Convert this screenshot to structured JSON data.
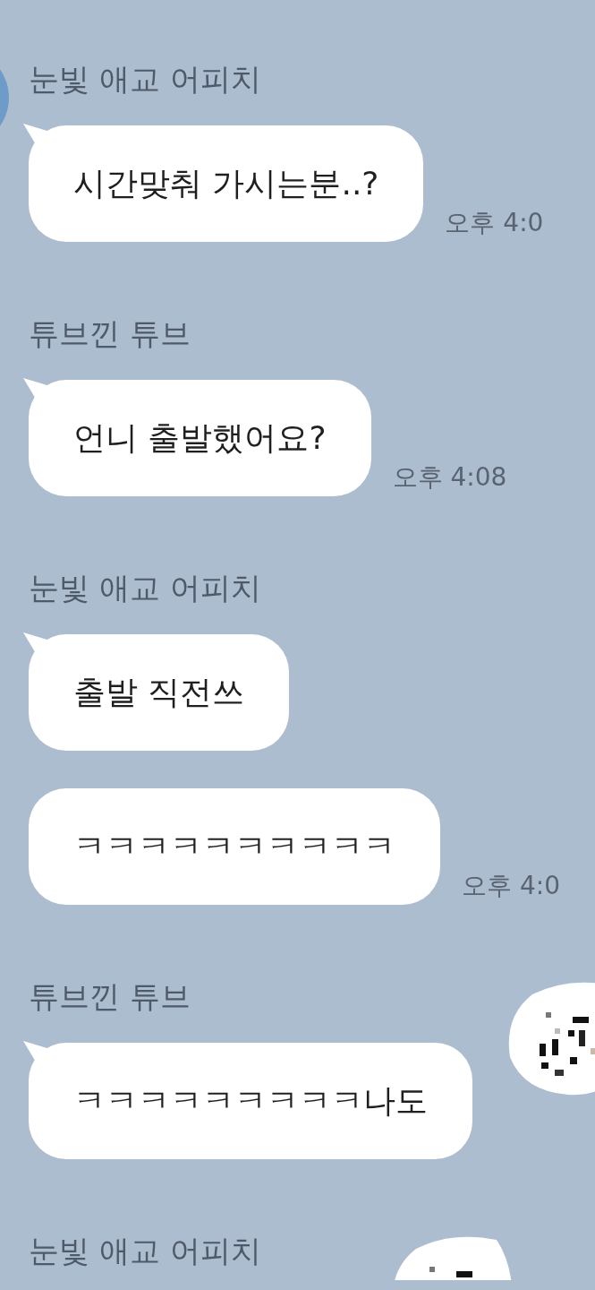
{
  "groups": [
    {
      "sender": "눈빛 애교 어피치",
      "avatar": true,
      "sticker": false,
      "messages": [
        {
          "text": "시간맞춰 가시는분..?",
          "time": "오후 4:0"
        }
      ]
    },
    {
      "sender": "튜브낀 튜브",
      "avatar": false,
      "sticker": false,
      "messages": [
        {
          "text": "언니 출발했어요?",
          "time": "오후 4:08"
        }
      ]
    },
    {
      "sender": "눈빛 애교 어피치",
      "avatar": false,
      "sticker": false,
      "messages": [
        {
          "text": "출발 직전쓰"
        },
        {
          "text": "ㅋㅋㅋㅋㅋㅋㅋㅋㅋㅋ",
          "time": "오후 4:0"
        }
      ]
    },
    {
      "sender": "튜브낀 튜브",
      "avatar": false,
      "sticker": true,
      "messages": [
        {
          "text": "ㅋㅋㅋㅋㅋㅋㅋㅋㅋ나도"
        }
      ]
    },
    {
      "sender": "눈빛 애교 어피치",
      "avatar": false,
      "sticker": true
    }
  ]
}
